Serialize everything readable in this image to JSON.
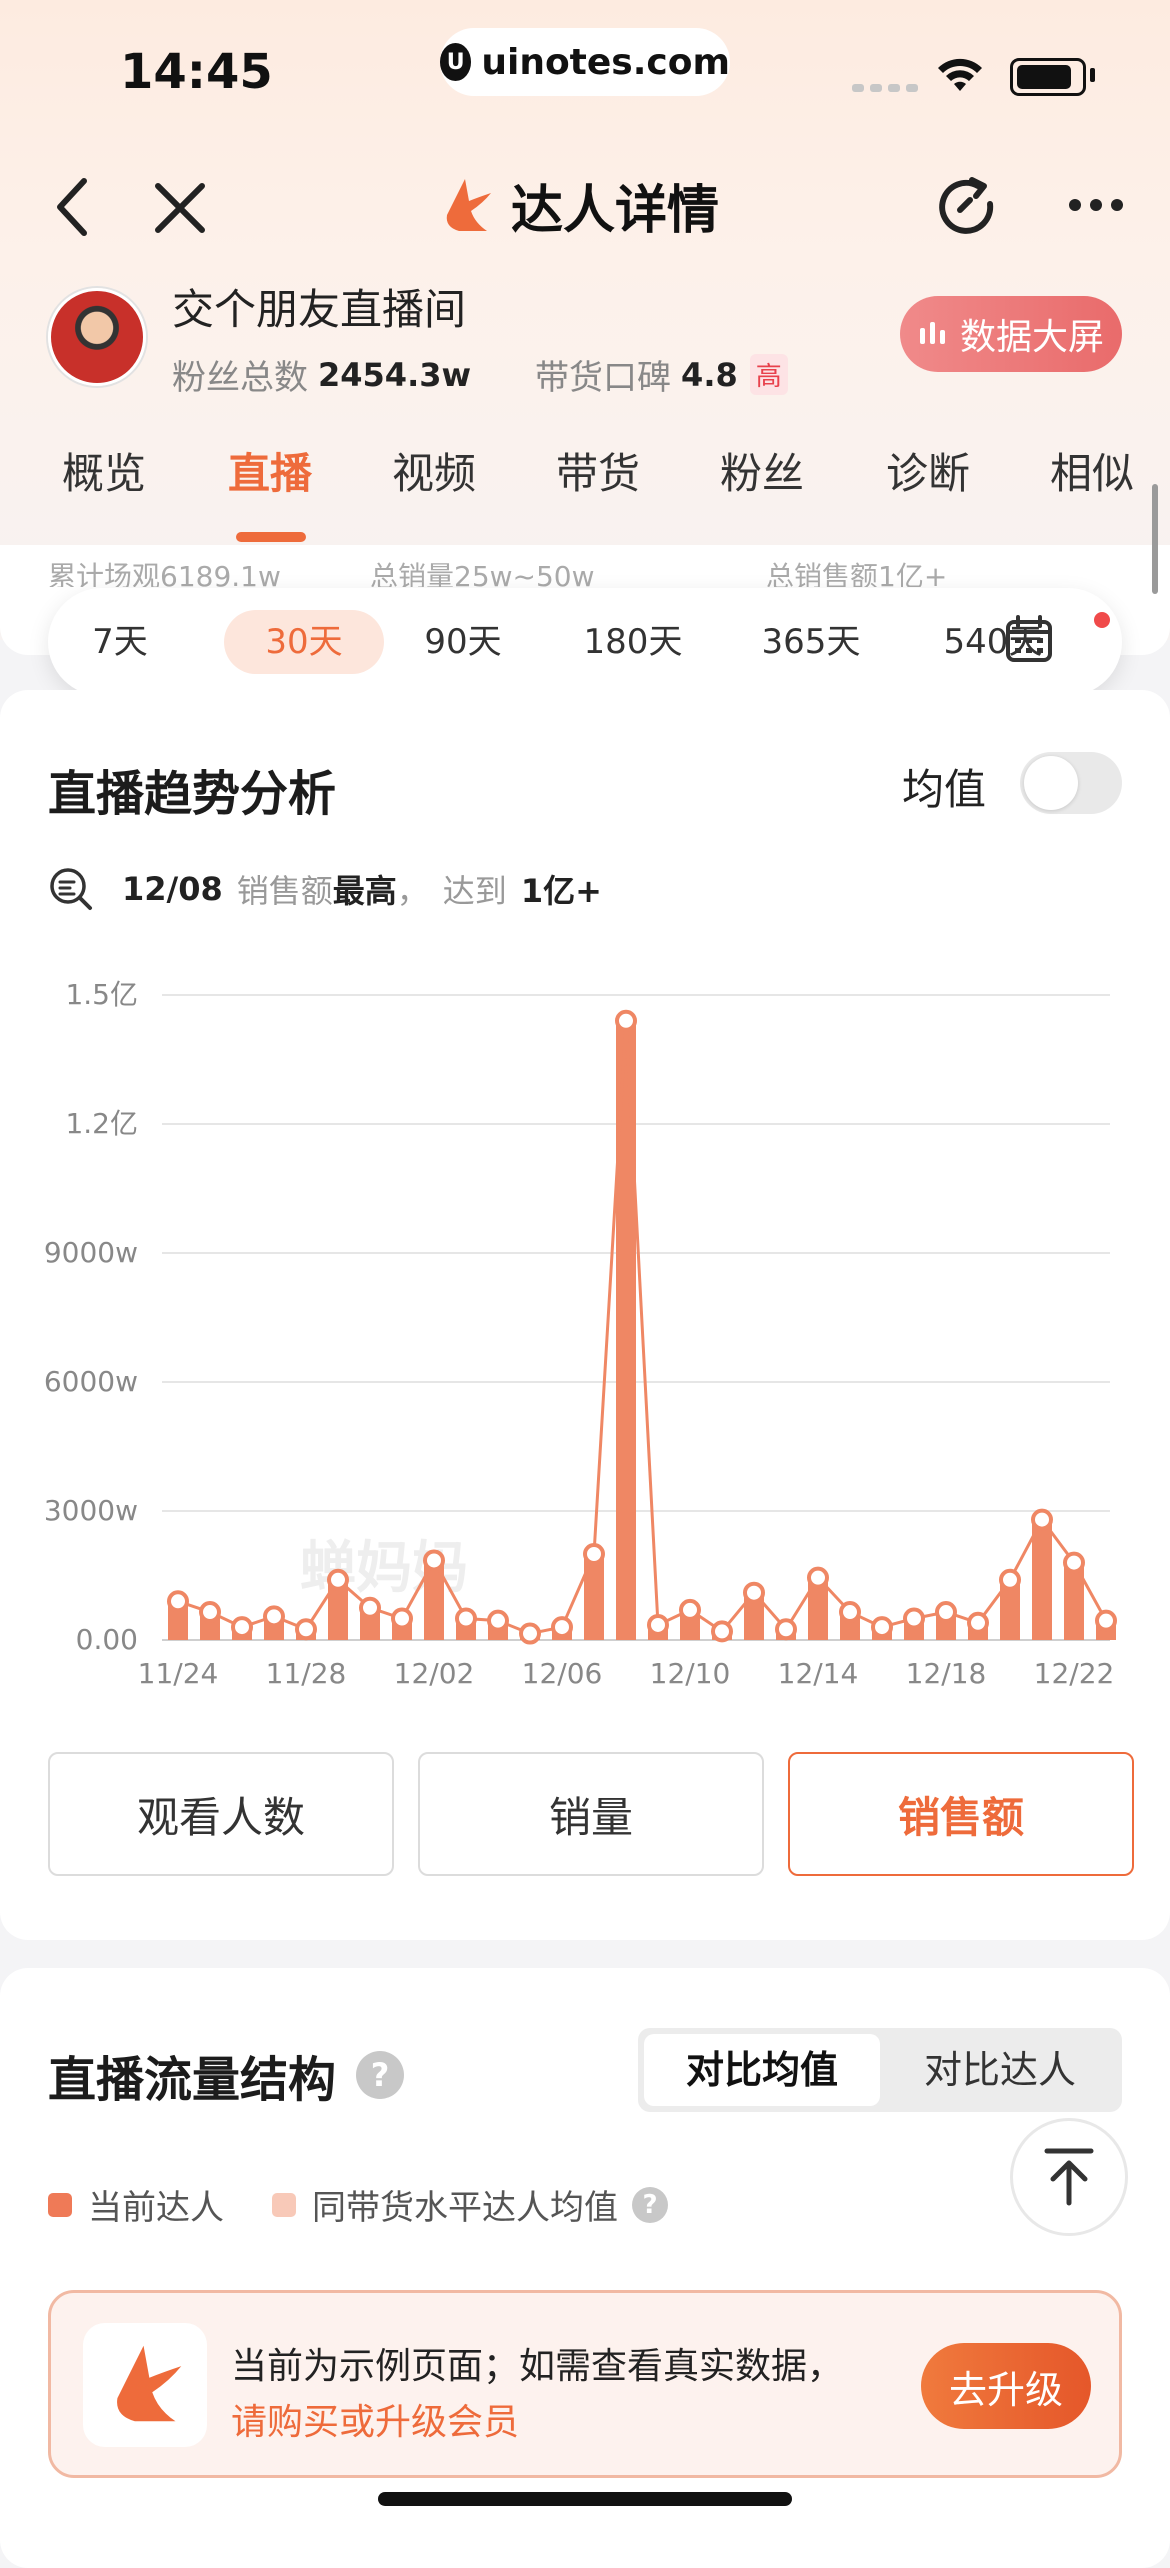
{
  "status_bar": {
    "time": "14:45",
    "url": "uinotes.com"
  },
  "nav": {
    "title": "达人详情"
  },
  "profile": {
    "name": "交个朋友直播间",
    "fans_label": "粉丝总数",
    "fans_value": "2454.3w",
    "rating_label": "带货口碑",
    "rating_value": "4.8",
    "rating_badge": "高",
    "data_screen_button": "数据大屏"
  },
  "tabs": [
    "概览",
    "直播",
    "视频",
    "带货",
    "粉丝",
    "诊断",
    "相似"
  ],
  "active_tab": "直播",
  "ghost_stats": [
    "累计场观6189.1w",
    "总销量25w~50w",
    "总销售额1亿+"
  ],
  "periods": [
    "7天",
    "30天",
    "90天",
    "180天",
    "365天",
    "540天"
  ],
  "active_period": "30天",
  "trend": {
    "title": "直播趋势分析",
    "avg_label": "均值",
    "insight": {
      "date": "12/08",
      "metric": "销售额",
      "word": "最高",
      "sep": "，",
      "reach": "达到",
      "value": "1亿+"
    },
    "watermark": "蝉妈妈"
  },
  "chart_data": {
    "type": "bar",
    "series_type": "bar+line",
    "metric": "销售额",
    "x": [
      "11/24",
      "11/25",
      "11/26",
      "11/27",
      "11/28",
      "11/29",
      "11/30",
      "12/01",
      "12/02",
      "12/03",
      "12/04",
      "12/05",
      "12/06",
      "12/07",
      "12/08",
      "12/09",
      "12/10",
      "12/11",
      "12/12",
      "12/13",
      "12/14",
      "12/15",
      "12/16",
      "12/17",
      "12/18",
      "12/19",
      "12/20",
      "12/21",
      "12/22",
      "12/23"
    ],
    "x_tick_labels": [
      "11/24",
      "11/28",
      "12/02",
      "12/06",
      "12/10",
      "12/14",
      "12/18",
      "12/22"
    ],
    "values": [
      900,
      650,
      300,
      550,
      250,
      1400,
      750,
      500,
      1850,
      500,
      450,
      150,
      300,
      2000,
      14400,
      350,
      700,
      200,
      1100,
      250,
      1450,
      650,
      300,
      500,
      650,
      400,
      1400,
      2800,
      1800,
      450
    ],
    "unit": "w",
    "y_ticks": [
      0,
      3000,
      6000,
      9000,
      12000,
      15000
    ],
    "y_tick_labels": [
      "0.00",
      "3000w",
      "6000w",
      "9000w",
      "1.2亿",
      "1.5亿"
    ],
    "ylim": [
      0,
      15000
    ],
    "grid": true,
    "color": "#ef8764"
  },
  "metric_buttons": [
    "观看人数",
    "销量",
    "销售额"
  ],
  "active_metric": "销售额",
  "traffic": {
    "title": "直播流量结构",
    "compare_avg": "对比均值",
    "compare_expert": "对比达人",
    "legend_current": "当前达人",
    "legend_avg": "同带货水平达人均值",
    "help": "?"
  },
  "banner": {
    "line1": "当前为示例页面；如需查看真实数据，",
    "line2": "请购买或升级会员",
    "button": "去升级"
  },
  "colors": {
    "accent": "#ee6b3b",
    "bar": "#ef8764",
    "legend_avg": "#f8c9b8"
  }
}
